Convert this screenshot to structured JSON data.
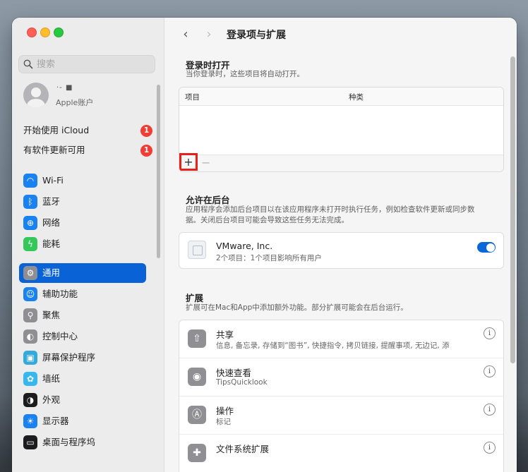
{
  "window": {
    "title": "登录项与扩展"
  },
  "sidebar": {
    "search_placeholder": "搜索",
    "account": {
      "name": "·- ■",
      "subtitle": "Apple账户"
    },
    "notices": [
      {
        "label": "开始使用 iCloud",
        "badge": "1"
      },
      {
        "label": "有软件更新可用",
        "badge": "1"
      }
    ],
    "groups": [
      [
        {
          "label": "Wi-Fi",
          "icon": "wifi-icon",
          "color": "#1a82f0",
          "glyph": "◠"
        },
        {
          "label": "蓝牙",
          "icon": "bluetooth-icon",
          "color": "#1a82f0",
          "glyph": "ᛒ"
        },
        {
          "label": "网络",
          "icon": "globe-icon",
          "color": "#1a82f0",
          "glyph": "⊕"
        },
        {
          "label": "能耗",
          "icon": "battery-icon",
          "color": "#34c759",
          "glyph": "ϟ"
        }
      ],
      [
        {
          "label": "通用",
          "icon": "gear-icon",
          "color": "#8e8e93",
          "glyph": "⚙",
          "active": true
        },
        {
          "label": "辅助功能",
          "icon": "accessibility-icon",
          "color": "#1a82f0",
          "glyph": "☺"
        },
        {
          "label": "聚焦",
          "icon": "magnifier-icon",
          "color": "#8e8e93",
          "glyph": "⚲"
        },
        {
          "label": "控制中心",
          "icon": "control-center-icon",
          "color": "#8e8e93",
          "glyph": "◐"
        },
        {
          "label": "屏幕保护程序",
          "icon": "screensaver-icon",
          "color": "#34aadc",
          "glyph": "▣"
        },
        {
          "label": "墙纸",
          "icon": "flower-icon",
          "color": "#35b8f0",
          "glyph": "✿"
        },
        {
          "label": "外观",
          "icon": "appearance-icon",
          "color": "#1c1c1e",
          "glyph": "◑"
        },
        {
          "label": "显示器",
          "icon": "brightness-icon",
          "color": "#1a82f0",
          "glyph": "☀"
        },
        {
          "label": "桌面与程序坞",
          "icon": "dock-icon",
          "color": "#1c1c1e",
          "glyph": "▭"
        }
      ]
    ]
  },
  "main": {
    "login_section": {
      "title": "登录时打开",
      "desc": "当你登录时，这些项目将自动打开。",
      "col_item": "项目",
      "col_kind": "种类",
      "add_label": "+",
      "remove_label": "−"
    },
    "background_section": {
      "title": "允许在后台",
      "desc": "应用程序会添加后台项目以在该应用程序未打开时执行任务，例如检查软件更新或同步数据。关闭后台项目可能会导致这些任务无法完成。",
      "vendor": {
        "name": "VMware, Inc.",
        "detail": "2个项目：1个项目影响所有用户",
        "enabled": true
      }
    },
    "extensions_section": {
      "title": "扩展",
      "desc": "扩展可在Mac和App中添加额外功能。部分扩展可能会在后台运行。",
      "items": [
        {
          "name": "共享",
          "detail": "信息, 备忘录, 存储到“图书”, 快捷指令, 拷贝链接, 提醒事项, 无边记, 添...",
          "icon": "share-icon",
          "glyph": "⇧"
        },
        {
          "name": "快速查看",
          "detail": "TipsQuicklook",
          "icon": "eye-icon",
          "glyph": "◉"
        },
        {
          "name": "操作",
          "detail": "标记",
          "icon": "markup-icon",
          "glyph": "Ⓐ"
        },
        {
          "name": "文件系统扩展",
          "detail": "",
          "icon": "puzzle-icon",
          "glyph": "✚"
        }
      ],
      "info_glyph": "i"
    }
  }
}
